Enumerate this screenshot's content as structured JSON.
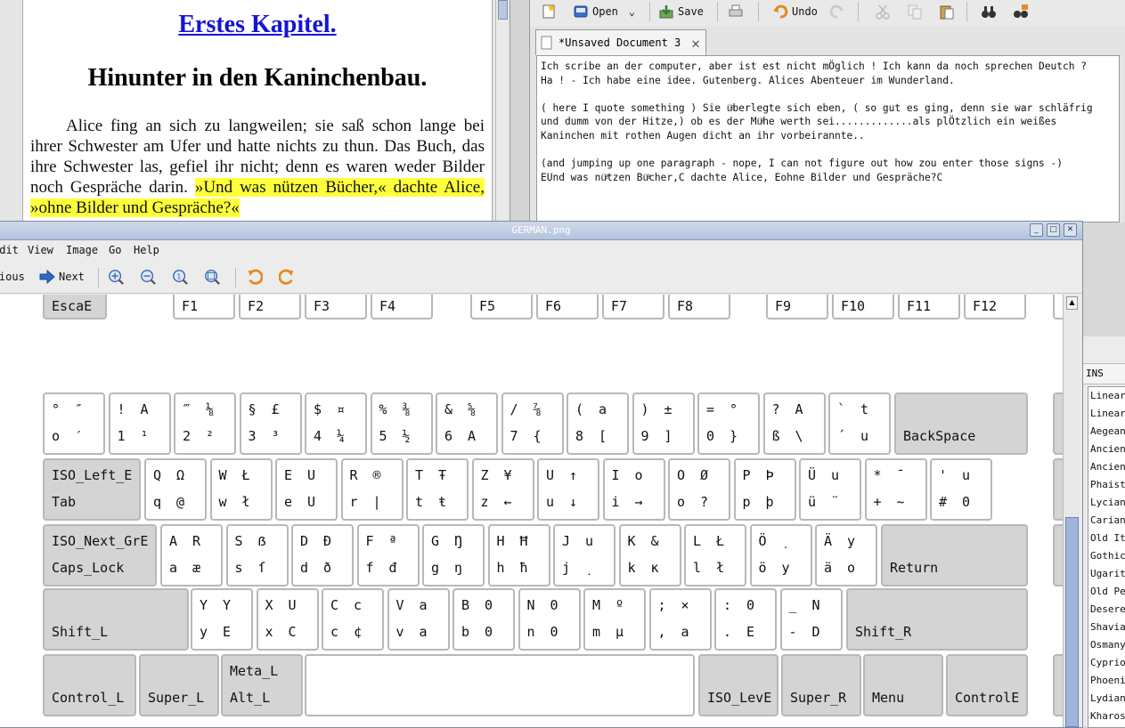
{
  "book": {
    "title": "Erstes Kapitel.",
    "subtitle": "Hinunter in den Kaninchenbau.",
    "paragraph": "Alice fing an sich zu langweilen; sie saß schon lange bei ihrer Schwester am Ufer und hatte nichts zu thun. Das Buch, das ihre Schwester las, gefiel ihr nicht; denn es waren weder Bilder noch Gespräche darin. ",
    "highlight": "»Und was nützen Bücher,« dachte Alice, »ohne Bilder und Gespräche?«"
  },
  "editor": {
    "toolbar": {
      "open_label": "Open",
      "save_label": "Save",
      "undo_label": "Undo"
    },
    "tab_label": "*Unsaved Document 3",
    "text": "Ich scribe an der computer, aber ist est nicht mÖglich ! Ich kann da noch sprechen Deutch ?\nHa ! - Ich habe eine idee. Gutenberg. Alices Abenteuer im Wunderland.\n\n( here I quote something ) Sie üͤberlegte sich eben, ( so gut es ging, denn sie war schläfrig\nund dumm von der Hitze,) ob es der Müͤhe werth sei.............als plÖtzlich ein weißes\nKaninchen mit rothen Augen dicht an ihr vorbeirannte..\n\n(and jumping up one paragraph - nope, I can not figure out how zou enter those signs -)\nEUnd was nüͤtzen Büͤcher,C dachte Alice, Eohne Bilder und Gespräche?C"
  },
  "viewer": {
    "window_title": "GERMAN.png",
    "menu": [
      "Edit",
      "View",
      "Image",
      "Go",
      "Help"
    ],
    "toolbar": {
      "previous_label": "Previous",
      "next_label": "Next"
    }
  },
  "keyboard": {
    "fn_row": [
      "EscaE",
      "F1",
      "F2",
      "F3",
      "F4",
      "F5",
      "F6",
      "F7",
      "F8",
      "F9",
      "F10",
      "F11",
      "F12"
    ],
    "row1": [
      [
        "°",
        "″",
        "o",
        "′"
      ],
      [
        "!",
        "A",
        "1",
        "¹"
      ],
      [
        "‴",
        "⅛",
        "2",
        "²"
      ],
      [
        "§",
        "£",
        "3",
        "³"
      ],
      [
        "$",
        "¤",
        "4",
        "¼"
      ],
      [
        "%",
        "⅜",
        "5",
        "½"
      ],
      [
        "&",
        "⅝",
        "6",
        "A"
      ],
      [
        "/",
        "⅞",
        "7",
        "{"
      ],
      [
        "(",
        "a",
        "8",
        "["
      ],
      [
        ")",
        "±",
        "9",
        "]"
      ],
      [
        "=",
        "°",
        "0",
        "}"
      ],
      [
        "?",
        "A",
        "ß",
        "\\"
      ],
      [
        "`",
        "t",
        "´",
        "u"
      ]
    ],
    "row1_end": "BackSpace",
    "row2_start": [
      "ISO_Left_E",
      "Tab"
    ],
    "row2": [
      [
        "Q",
        "Ω",
        "q",
        "@"
      ],
      [
        "W",
        "Ł",
        "w",
        "ł"
      ],
      [
        "E",
        "U",
        "e",
        "U"
      ],
      [
        "R",
        "®",
        "r",
        "|"
      ],
      [
        "T",
        "Ŧ",
        "t",
        "ŧ"
      ],
      [
        "Z",
        "¥",
        "z",
        "←"
      ],
      [
        "U",
        "↑",
        "u",
        "↓"
      ],
      [
        "I",
        "o",
        "i",
        "→"
      ],
      [
        "O",
        "Ø",
        "o",
        "?"
      ],
      [
        "P",
        "Þ",
        "p",
        "þ"
      ],
      [
        "Ü",
        "u",
        "ü",
        "¨"
      ],
      [
        "*",
        "¯",
        "+",
        "~"
      ],
      [
        "'",
        "u",
        "#",
        "0"
      ]
    ],
    "row3_start": [
      "ISO_Next_GrE",
      "Caps_Lock"
    ],
    "row3": [
      [
        "A",
        "R",
        "a",
        "æ"
      ],
      [
        "S",
        "ẞ",
        "s",
        "ſ"
      ],
      [
        "D",
        "Đ",
        "d",
        "ð"
      ],
      [
        "F",
        "ª",
        "f",
        "đ"
      ],
      [
        "G",
        "Ŋ",
        "g",
        "ŋ"
      ],
      [
        "H",
        "Ħ",
        "h",
        "ħ"
      ],
      [
        "J",
        "u",
        "j",
        "̣"
      ],
      [
        "K",
        "&",
        "k",
        "ĸ"
      ],
      [
        "L",
        "Ł",
        "l",
        "ł"
      ],
      [
        "Ö",
        "̣",
        "ö",
        "y"
      ],
      [
        "Ä",
        "y",
        "ä",
        "o"
      ]
    ],
    "row3_end": "Return",
    "row4_start": "Shift_L",
    "row4": [
      [
        "Y",
        "Y",
        "y",
        "E"
      ],
      [
        "X",
        "U",
        "x",
        "C"
      ],
      [
        "C",
        "c",
        "c",
        "¢"
      ],
      [
        "V",
        "a",
        "v",
        "a"
      ],
      [
        "B",
        "0",
        "b",
        "0"
      ],
      [
        "N",
        "0",
        "n",
        "0"
      ],
      [
        "M",
        "º",
        "m",
        "µ"
      ],
      [
        ";",
        "×",
        ",",
        "a"
      ],
      [
        ":",
        "0",
        ".",
        "E"
      ],
      [
        "_",
        "N",
        "-",
        "D"
      ]
    ],
    "row4_end": "Shift_R",
    "row5": [
      "Control_L",
      "Super_L",
      [
        "Meta_L",
        "Alt_L"
      ],
      "",
      "ISO_LevE",
      "Super_R",
      "Menu",
      "ControlE"
    ]
  },
  "charmap": {
    "ins_label": "INS",
    "scripts": [
      "Linear B",
      "Linear B",
      "Aegean",
      "Ancient",
      "Ancient",
      "Phaistos",
      "Lycian",
      "Carian",
      "Old Italic",
      "Gothic",
      "Ugaritic",
      "Old Persian",
      "Deseret",
      "Shavian",
      "Osmanya",
      "Cypriot",
      "Phoenician",
      "Lydian",
      "Kharoshthi"
    ]
  }
}
